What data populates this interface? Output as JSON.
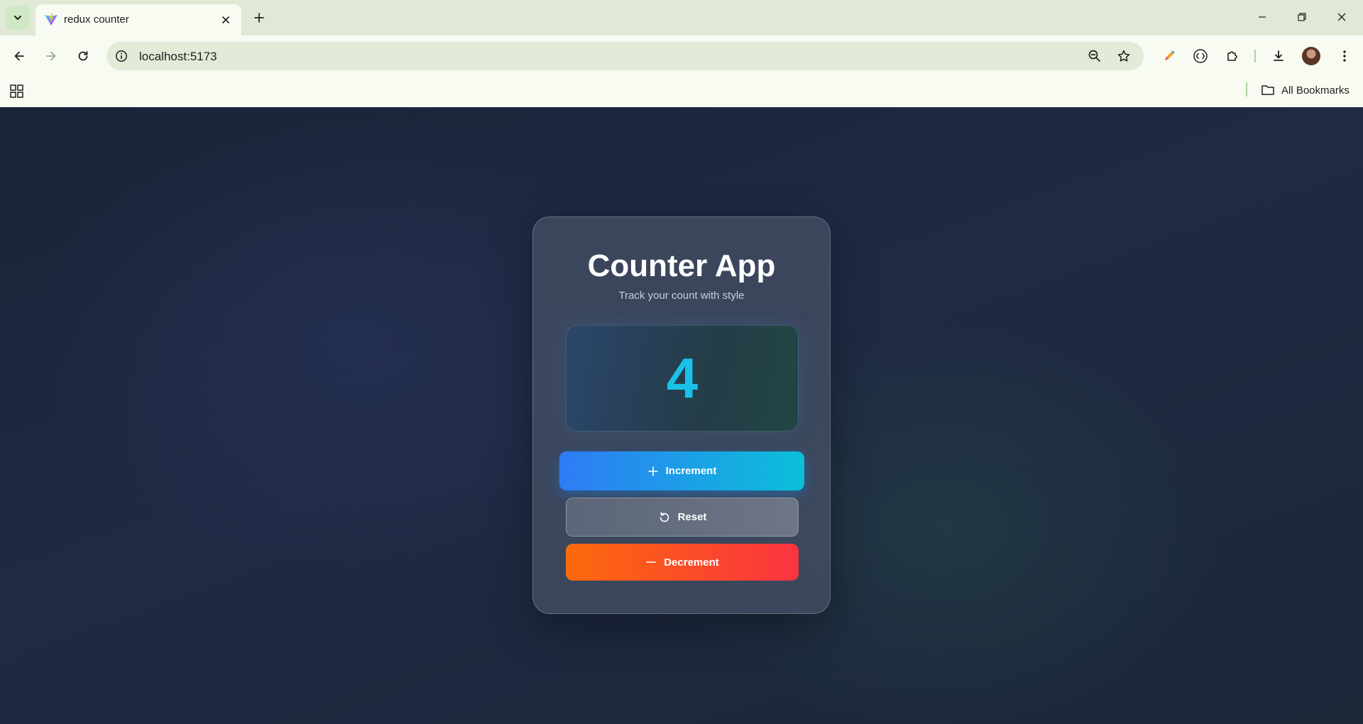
{
  "browser": {
    "tab_title": "redux counter",
    "url": "localhost:5173",
    "bookmarks_label": "All Bookmarks",
    "accent_color": "#a8d69a"
  },
  "app": {
    "title": "Counter App",
    "subtitle": "Track your count with style",
    "count": "4",
    "count_color": "#17c1e8",
    "buttons": {
      "increment_label": "Increment",
      "reset_label": "Reset",
      "decrement_label": "Decrement"
    },
    "colors": {
      "increment_gradient": [
        "#2f7bf5",
        "#0bbfd9"
      ],
      "reset_gradient": [
        "#5c6678",
        "#6e7686"
      ],
      "decrement_gradient": [
        "#fb6a0c",
        "#fb3340"
      ]
    },
    "icons": {
      "increment": "plus-icon",
      "reset": "reset-icon",
      "decrement": "minus-icon"
    }
  }
}
